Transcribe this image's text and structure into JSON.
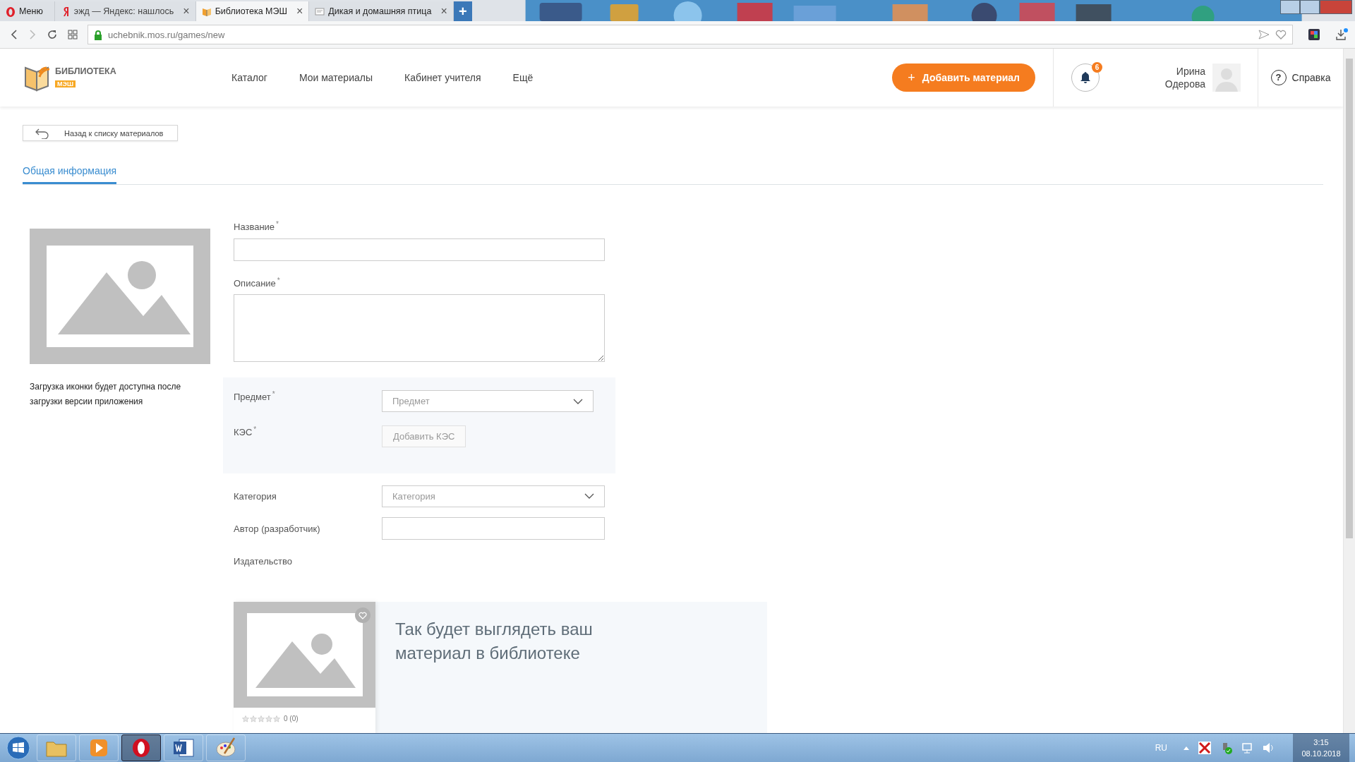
{
  "browser": {
    "tabs": [
      {
        "title": "Меню",
        "kind": "menu",
        "selected": false
      },
      {
        "title": "эжд — Яндекс: нашлось",
        "kind": "yandex",
        "selected": false,
        "close": "×"
      },
      {
        "title": "Библиотека МЭШ",
        "kind": "book",
        "selected": true,
        "close": "×"
      },
      {
        "title": "Дикая и домашняя птица",
        "kind": "page",
        "selected": false,
        "close": "×"
      }
    ],
    "new_tab": "+",
    "address": "uchebnik.mos.ru/games/new"
  },
  "header": {
    "logo_title": "БИБЛИОТЕКА",
    "logo_sub": "МЭШ",
    "nav": [
      {
        "label": "Каталог"
      },
      {
        "label": "Мои материалы"
      },
      {
        "label": "Кабинет учителя"
      },
      {
        "label": "Ещё"
      }
    ],
    "add_button": {
      "icon": "+",
      "label": "Добавить материал"
    },
    "notifications": "6",
    "user_name": "Ирина Одерова",
    "help": {
      "icon": "?",
      "label": "Справка"
    }
  },
  "back_button": "Назад к списку материалов",
  "tabs": [
    {
      "label": "Общая информация",
      "selected": true
    }
  ],
  "icon_caption": "Загрузка иконки будет доступна после загрузки версии приложения",
  "form": {
    "required_mark": "*",
    "fields": [
      {
        "kind": "text",
        "label": "Название",
        "required": true
      },
      {
        "kind": "textarea",
        "label": "Описание",
        "required": true
      }
    ],
    "panel": [
      {
        "kind": "select",
        "label": "Предмет",
        "required": true,
        "placeholder": "Предмет"
      },
      {
        "kind": "button",
        "label": "КЭС",
        "required": true,
        "button": "Добавить КЭС"
      }
    ],
    "extra": [
      {
        "kind": "select",
        "label": "Категория",
        "required": false,
        "placeholder": "Категория"
      },
      {
        "kind": "text",
        "label": "Автор (разработчик)",
        "required": false
      },
      {
        "kind": "none",
        "label": "Издательство",
        "required": false
      }
    ]
  },
  "preview": {
    "stars": 0,
    "rating": "0 (0)",
    "heading": "Так будет выглядеть ваш материал в библиотеке"
  },
  "taskbar": {
    "apps": [
      {
        "kind": "folder",
        "selected": false
      },
      {
        "kind": "player",
        "selected": false
      },
      {
        "kind": "opera",
        "selected": true
      },
      {
        "kind": "word",
        "selected": false
      },
      {
        "kind": "paint",
        "selected": false
      }
    ],
    "language": "RU",
    "time": "3:15",
    "date": "08.10.2018"
  }
}
